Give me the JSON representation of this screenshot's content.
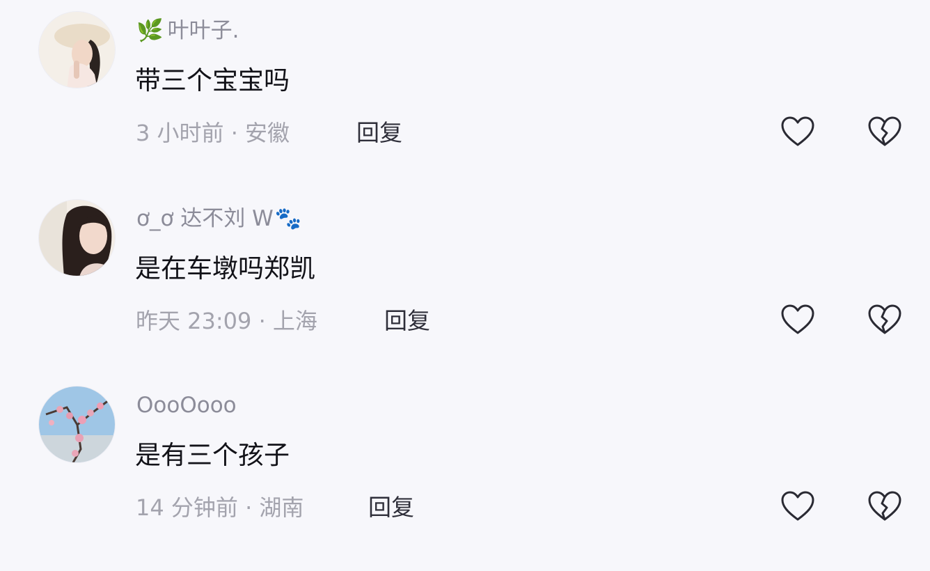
{
  "comments": [
    {
      "username": "叶叶子.",
      "badge": "🌿",
      "content": "带三个宝宝吗",
      "meta": "3 小时前 · 安徽",
      "reply_label": "回复"
    },
    {
      "username": "ơ_ơ 达不刘 W",
      "badge_suffix": "🐾",
      "content": "是在车墩吗郑凯",
      "meta": "昨天 23:09 · 上海",
      "reply_label": "回复"
    },
    {
      "username": "OooOooo",
      "content": "是有三个孩子",
      "meta": "14 分钟前 · 湖南",
      "reply_label": "回复"
    }
  ],
  "icons": {
    "like": "heart-outline-icon",
    "dislike": "broken-heart-icon"
  },
  "colors": {
    "background": "#f7f7fb",
    "username": "#8c8c99",
    "content": "#121218",
    "meta": "#a3a3ad",
    "reply": "#2f2f3a",
    "icon_stroke": "#2a2a33"
  }
}
